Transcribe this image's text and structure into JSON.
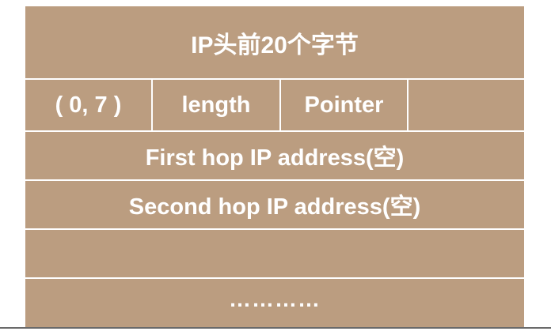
{
  "colors": {
    "fill": "#bb9d80",
    "line": "#ffffff",
    "text": "#ffffff"
  },
  "header": {
    "title": "IP头前20个字节"
  },
  "option_row": {
    "type": "( 0, 7 )",
    "length": "length",
    "pointer": "Pointer",
    "empty": ""
  },
  "rows": {
    "first_hop": "First hop IP address(空)",
    "second_hop": "Second hop IP address(空)",
    "empty": "",
    "ellipsis": "…………"
  }
}
